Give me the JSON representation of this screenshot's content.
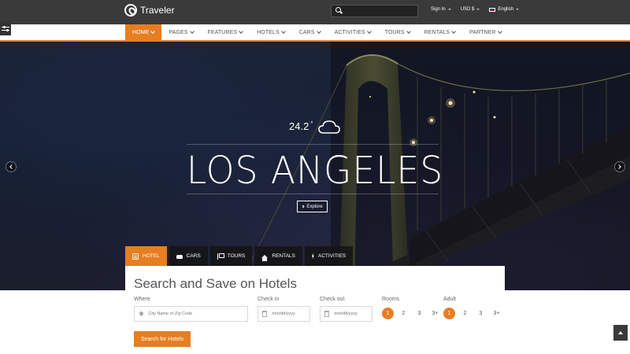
{
  "brand": {
    "name": "Traveler"
  },
  "topbar": {
    "search_placeholder": "",
    "links": [
      {
        "label": "Sign In"
      },
      {
        "label": "USD $"
      },
      {
        "label": "English"
      }
    ]
  },
  "nav": {
    "items": [
      {
        "label": "HOME"
      },
      {
        "label": "PAGES"
      },
      {
        "label": "FEATURES"
      },
      {
        "label": "HOTELS"
      },
      {
        "label": "CARS"
      },
      {
        "label": "ACTIVITIES"
      },
      {
        "label": "TOURS"
      },
      {
        "label": "RENTALS"
      },
      {
        "label": "PARTNER"
      }
    ]
  },
  "hero": {
    "temperature": "24.2",
    "degree": "°",
    "weather_icon": "cloud-icon",
    "city": "LOS ANGELES",
    "explore_label": "Explore"
  },
  "search_tabs": [
    {
      "label": "HOTEL",
      "icon": "hotel-icon"
    },
    {
      "label": "CARS",
      "icon": "car-icon"
    },
    {
      "label": "TOURS",
      "icon": "flag-icon"
    },
    {
      "label": "RENTALS",
      "icon": "home-icon"
    },
    {
      "label": "ACTIVITIES",
      "icon": "bolt-icon"
    }
  ],
  "search_form": {
    "title": "Search and Save on Hotels",
    "where_label": "Where",
    "where_placeholder": "City Name or Zip Code",
    "checkin_label": "Check in",
    "checkin_placeholder": "mm/dd/yyyy",
    "checkout_label": "Check out",
    "checkout_placeholder": "mm/dd/yyyy",
    "rooms_label": "Rooms",
    "rooms_options": [
      "1",
      "2",
      "3",
      "3+"
    ],
    "rooms_selected": "1",
    "adult_label": "Adult",
    "adult_options": [
      "1",
      "2",
      "3",
      "3+"
    ],
    "adult_selected": "1",
    "submit_label": "Search for Hotels"
  },
  "colors": {
    "accent": "#e67e22",
    "topbar": "#3a3a3a"
  }
}
